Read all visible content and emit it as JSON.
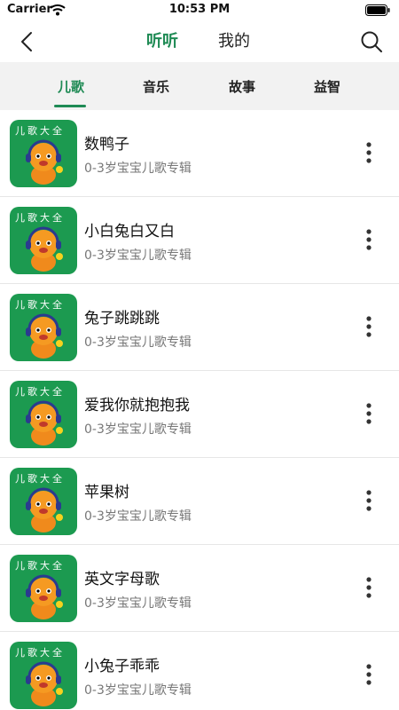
{
  "status_bar": {
    "carrier": "Carrier",
    "time": "10:53 PM"
  },
  "nav": {
    "tabs": [
      {
        "label": "听听",
        "active": true
      },
      {
        "label": "我的",
        "active": false
      }
    ]
  },
  "categories": [
    {
      "label": "儿歌",
      "active": true
    },
    {
      "label": "音乐",
      "active": false
    },
    {
      "label": "故事",
      "active": false
    },
    {
      "label": "益智",
      "active": false
    }
  ],
  "cover_badge": "儿歌大全",
  "albums": [
    {
      "title": "数鸭子",
      "subtitle": "0-3岁宝宝儿歌专辑"
    },
    {
      "title": "小白兔白又白",
      "subtitle": "0-3岁宝宝儿歌专辑"
    },
    {
      "title": "兔子跳跳跳",
      "subtitle": "0-3岁宝宝儿歌专辑"
    },
    {
      "title": "爱我你就抱抱我",
      "subtitle": "0-3岁宝宝儿歌专辑"
    },
    {
      "title": "苹果树",
      "subtitle": "0-3岁宝宝儿歌专辑"
    },
    {
      "title": "英文字母歌",
      "subtitle": "0-3岁宝宝儿歌专辑"
    },
    {
      "title": "小兔子乖乖",
      "subtitle": "0-3岁宝宝儿歌专辑"
    }
  ],
  "colors": {
    "accent": "#1e8a54",
    "cover_bg": "#1c9a50",
    "category_bar_bg": "#f2f2f2"
  }
}
